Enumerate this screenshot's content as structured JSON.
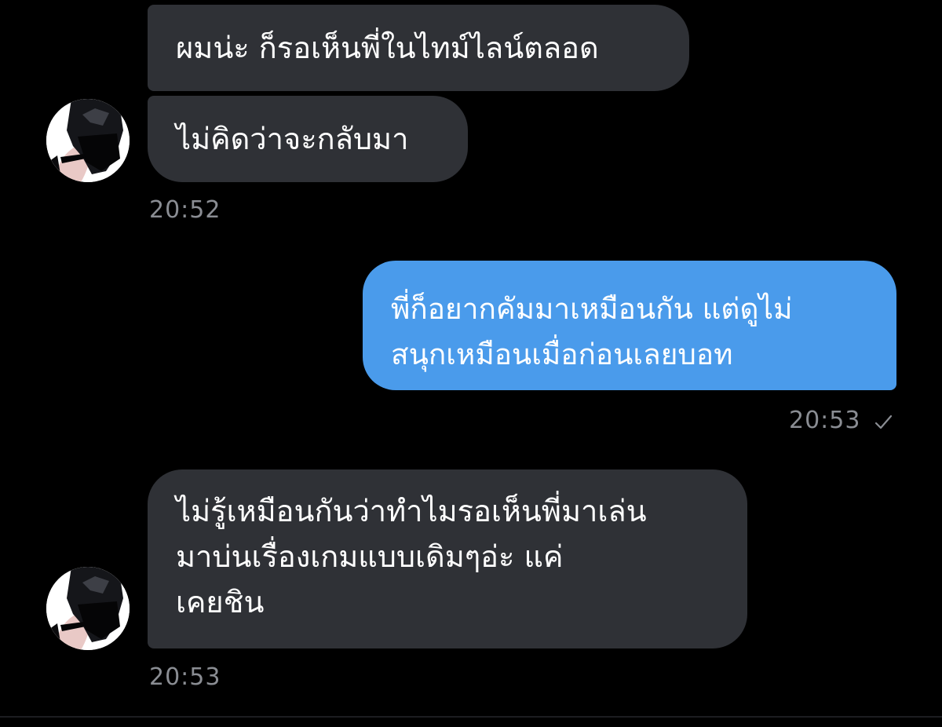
{
  "messages": [
    {
      "id": "msg1",
      "direction": "incoming",
      "lines": [
        "ผมน่ะ ก็รอเห็นพี่ในไทม์ไลน์ตลอด"
      ]
    },
    {
      "id": "msg2",
      "direction": "incoming",
      "lines": [
        "ไม่คิดว่าจะกลับมา"
      ],
      "time": "20:52"
    },
    {
      "id": "msg3",
      "direction": "outgoing",
      "lines": [
        "พี่ก็อยากคัมมาเหมือนกัน แต่ดูไม่",
        "สนุกเหมือนเมื่อก่อนเลยบอท"
      ],
      "time": "20:53",
      "status_icon": "check-icon"
    },
    {
      "id": "msg4",
      "direction": "incoming",
      "lines": [
        "ไม่รู้เหมือนกันว่าทำไมรอเห็นพี่มาเล่น",
        "มาบ่นเรื่องเกมแบบเดิมๆอ่ะ แค่",
        "เคยชิน"
      ],
      "time": "20:53"
    }
  ],
  "colors": {
    "background": "#000000",
    "incoming_bubble": "#2f3136",
    "outgoing_bubble": "#4a9beb",
    "timestamp": "#8a8d93"
  }
}
